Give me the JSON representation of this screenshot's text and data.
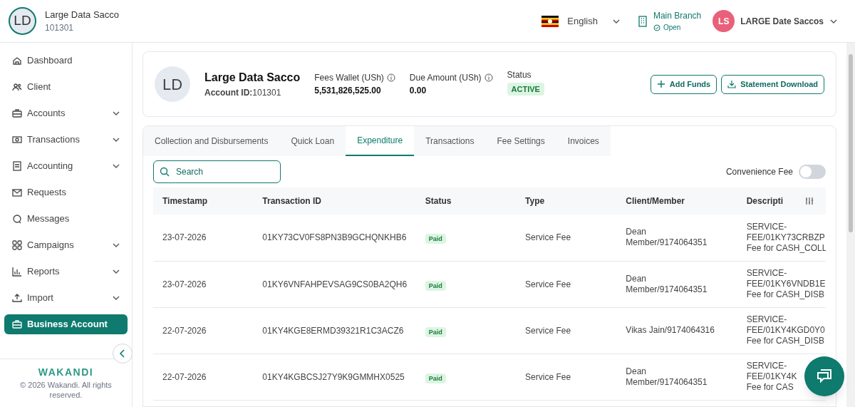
{
  "org": {
    "initials": "LD",
    "name": "Large Data Sacco",
    "id": "101301"
  },
  "topbar": {
    "language": "English",
    "branch": {
      "name": "Main Branch",
      "state": "Open"
    },
    "user": {
      "initials": "LS",
      "name": "LARGE Date Saccos"
    }
  },
  "sidebar": {
    "items": [
      {
        "label": "Dashboard",
        "expandable": false,
        "selected": false
      },
      {
        "label": "Client",
        "expandable": false,
        "selected": false
      },
      {
        "label": "Accounts",
        "expandable": true,
        "selected": false
      },
      {
        "label": "Transactions",
        "expandable": true,
        "selected": false
      },
      {
        "label": "Accounting",
        "expandable": true,
        "selected": false
      },
      {
        "label": "Requests",
        "expandable": false,
        "selected": false
      },
      {
        "label": "Messages",
        "expandable": false,
        "selected": false
      },
      {
        "label": "Campaigns",
        "expandable": true,
        "selected": false
      },
      {
        "label": "Reports",
        "expandable": true,
        "selected": false
      },
      {
        "label": "Import",
        "expandable": true,
        "selected": false
      },
      {
        "label": "Business Account",
        "expandable": false,
        "selected": true
      }
    ],
    "brand": "WAKANDI",
    "copyright": "© 2026 Wakandi. All rights reserved."
  },
  "account": {
    "initials": "LD",
    "name": "Large Data Sacco",
    "id_label": "Account ID:",
    "id": "101301",
    "fees_wallet_label": "Fees Wallet (USh)",
    "fees_wallet": "5,531,826,525.00",
    "due_label": "Due Amount (USh)",
    "due": "0.00",
    "status_label": "Status",
    "status": "ACTIVE",
    "buttons": [
      "Add Funds",
      "Statement Download"
    ]
  },
  "tabs": [
    {
      "label": "Collection and Disbursements",
      "selected": false
    },
    {
      "label": "Quick Loan",
      "selected": false
    },
    {
      "label": "Expenditure",
      "selected": true
    },
    {
      "label": "Transactions",
      "selected": false
    },
    {
      "label": "Fee Settings",
      "selected": false
    },
    {
      "label": "Invoices",
      "selected": false
    }
  ],
  "search": {
    "placeholder": "Search"
  },
  "convenience_fee": {
    "label": "Convenience Fee",
    "on": false
  },
  "table": {
    "columns": [
      "Timestamp",
      "Transaction ID",
      "Status",
      "Type",
      "Client/Member",
      "Descripti"
    ],
    "rows": [
      {
        "timestamp": "23-07-2026",
        "transaction_id": "01KY73CV0FS8PN3B9GCHQNKHB6",
        "status": "Paid",
        "type": "Service Fee",
        "client": "Dean Member/9174064351",
        "description": [
          "SERVICE-",
          "FEE/01KY73CRBZP",
          "Fee for CASH_COLL"
        ]
      },
      {
        "timestamp": "23-07-2026",
        "transaction_id": "01KY6VNFAHPEVSAG9CS0BA2QH6",
        "status": "Paid",
        "type": "Service Fee",
        "client": "Dean Member/9174064351",
        "description": [
          "SERVICE-",
          "FEE/01KY6VNDB1E",
          "Fee for CASH_DISB"
        ]
      },
      {
        "timestamp": "22-07-2026",
        "transaction_id": "01KY4KGE8ERMD39321R1C3ACZ6",
        "status": "Paid",
        "type": "Service Fee",
        "client": "Vikas Jain/9174064316",
        "description": [
          "SERVICE-",
          "FEE/01KY4KGD0Y0",
          "Fee for CASH_DISB"
        ]
      },
      {
        "timestamp": "22-07-2026",
        "transaction_id": "01KY4KGBCSJ27Y9K9GMMHX0525",
        "status": "Paid",
        "type": "Service Fee",
        "client": "Dean Member/9174064351",
        "description": [
          "SERVICE-",
          "FEE/01KY4K",
          "Fee for CAS"
        ]
      }
    ]
  }
}
